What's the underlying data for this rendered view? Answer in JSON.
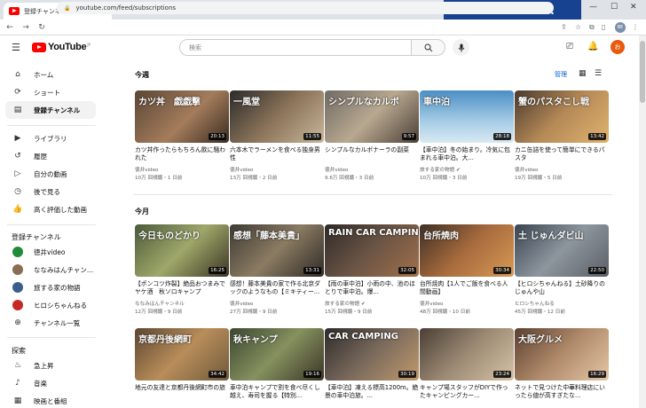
{
  "browser": {
    "tab_title": "登録チャンネル - YouTube",
    "url": "youtube.com/feed/subscriptions",
    "brand": "Buzzword Inc.",
    "profile_initials": "BE"
  },
  "header": {
    "logo": "YouTube",
    "logo_region": "JP",
    "search_placeholder": "検索",
    "avatar_letter": "お"
  },
  "sidebar": {
    "main": [
      {
        "label": "ホーム",
        "icon": "⌂"
      },
      {
        "label": "ショート",
        "icon": "⟳"
      },
      {
        "label": "登録チャンネル",
        "icon": "▤"
      }
    ],
    "library": [
      {
        "label": "ライブラリ",
        "icon": "▶"
      },
      {
        "label": "履歴",
        "icon": "↺"
      },
      {
        "label": "自分の動画",
        "icon": "▷"
      },
      {
        "label": "後で見る",
        "icon": "◷"
      },
      {
        "label": "高く評価した動画",
        "icon": "👍"
      }
    ],
    "subs_heading": "登録チャンネル",
    "subs": [
      {
        "label": "徳井video",
        "color": "#1f8b3b"
      },
      {
        "label": "ななみはんチャン...",
        "color": "#8a6d52"
      },
      {
        "label": "旅する家の物語",
        "color": "#3a5e8c"
      },
      {
        "label": "ヒロシちゃんねる",
        "color": "#c62828"
      },
      {
        "label": "チャンネル一覧",
        "icon": "⊕"
      }
    ],
    "explore_heading": "探索",
    "explore": [
      {
        "label": "急上昇",
        "icon": "♨"
      },
      {
        "label": "音楽",
        "icon": "♪"
      },
      {
        "label": "映画と番組",
        "icon": "▦"
      }
    ]
  },
  "sections": {
    "this_week": "今週",
    "this_month": "今月",
    "manage": "管理"
  },
  "row1": [
    {
      "title": "カツ丼作ったらもちろん飲に騒われた",
      "channel": "徳井video",
      "meta": "10万 回視聴・1 日前",
      "duration": "20:13",
      "caption": "カツ丼　戯戯撃",
      "bg": "linear-gradient(135deg,#5a4636,#a47c5b 55%,#3a2c22)"
    },
    {
      "title": "六本木でラーメンを食べる独身男性",
      "channel": "徳井video",
      "meta": "13万 回視聴・2 日前",
      "duration": "11:55",
      "caption": "一風堂",
      "bg": "linear-gradient(135deg,#2b2b2b,#8a7358 50%,#c9b79c)"
    },
    {
      "title": "シンプルなカルボナーラの副菜",
      "channel": "徳井video",
      "meta": "9.6万 回視聴・3 日前",
      "duration": "9:57",
      "caption": "シンプルなカルボ",
      "bg": "linear-gradient(135deg,#6f6a63,#b8a890 50%,#4b4036)"
    },
    {
      "title": "【車中泊】冬の始まり。冷気に包まれる車中泊。大...",
      "channel": "旅する家の物語",
      "meta": "10万 回視聴・3 日前",
      "duration": "28:18",
      "caption": "車中泊",
      "bg": "linear-gradient(180deg,#4b8fc4,#a8cde6 60%,#d9e9f3)",
      "verified": true
    },
    {
      "title": "カニ缶詰を使って簡単にできるパスタ",
      "channel": "徳井video",
      "meta": "19万 回視聴・5 日前",
      "duration": "13:42",
      "caption": "蟹のパスタこし戦",
      "bg": "linear-gradient(135deg,#4a3a2e,#b68a57 50%,#e0b36f)"
    }
  ],
  "row2": [
    {
      "title": "【ポンコツ炸裂】絶品おつまみでヤケ酒　秋ソロキャンプ",
      "channel": "ななみはんチャンネル",
      "meta": "12万 回視聴・9 日前",
      "duration": "16:25",
      "caption": "今日ものどかり",
      "bg": "linear-gradient(135deg,#4b5a3a,#9fa86a 50%,#3c3524)"
    },
    {
      "title": "感想！藤本美貴の家で作る北京ダックのようなもの【ミキティー...",
      "channel": "徳井video",
      "meta": "27万 回視聴・9 日前",
      "duration": "13:31",
      "caption": "感想「藤本美貴」",
      "bg": "linear-gradient(135deg,#3d3a34,#8b7b62 50%,#2e2a25)"
    },
    {
      "title": "【雨の車中泊】小雨の中、池のほとりで車中泊。爆...",
      "channel": "旅する家の物語",
      "meta": "15万 回視聴・9 日前",
      "duration": "32:05",
      "caption": "RAIN CAR CAMPIN",
      "bg": "linear-gradient(135deg,#2f2a28,#6b5545 50%,#a2704a)",
      "verified": true
    },
    {
      "title": "台所焼肉【1人でご飯を食べる人間動画】",
      "channel": "徳井video",
      "meta": "48万 回視聴・10 日前",
      "duration": "30:34",
      "caption": "台所焼肉",
      "bg": "linear-gradient(135deg,#3e2f25,#a86b3d 50%,#d89a55)"
    },
    {
      "title": "【ヒロシちゃんねる】土砂降りのじゅんや山",
      "channel": "ヒロシちゃんねる",
      "meta": "45万 回視聴・12 日前",
      "duration": "22:50",
      "caption": "土 じゅんダビ山",
      "bg": "linear-gradient(135deg,#3a4450,#8d969e 50%,#5b5f64)"
    }
  ],
  "row3": [
    {
      "title": "地元の友達と京都丹後網町市の旅",
      "channel": "",
      "meta": "",
      "duration": "34:42",
      "caption": "京都丹後網町",
      "bg": "linear-gradient(135deg,#5c4731,#b98d5a 50%,#6e5a3c)"
    },
    {
      "title": "車中泊キャンプで割を食べ尽くし越え、寿司を握る【特別...",
      "channel": "",
      "meta": "",
      "duration": "19:16",
      "caption": "秋キャンプ",
      "bg": "linear-gradient(135deg,#3b4630,#85915e 50%,#3a3526)"
    },
    {
      "title": "【車中泊】凍える標高1200m。絶景の車中泊旅。...",
      "channel": "",
      "meta": "",
      "duration": "30:19",
      "caption": "CAR CAMPING",
      "bg": "linear-gradient(135deg,#2e2b2a,#7a6a5c 50%,#c19a6d)"
    },
    {
      "title": "キャンプ場スタッフがDIYで作ったキャンピングカー...",
      "channel": "",
      "meta": "",
      "duration": "23:24",
      "caption": "",
      "bg": "linear-gradient(135deg,#4a3f35,#9c8a74 50%,#d6c3a6)"
    },
    {
      "title": "ネットで見つけた中華料理店にいったら値が高すぎたな...",
      "channel": "",
      "meta": "",
      "duration": "16:29",
      "caption": "大阪グルメ",
      "bg": "linear-gradient(135deg,#5a4030,#b08a6a 50%,#e4c7a7)"
    }
  ]
}
